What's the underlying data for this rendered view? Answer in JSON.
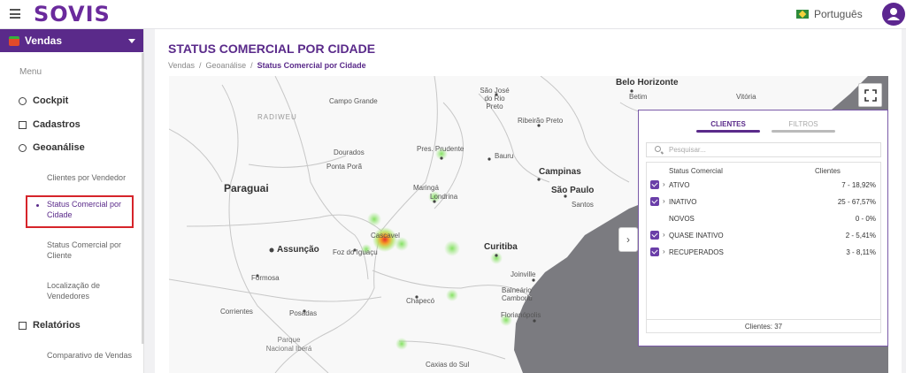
{
  "header": {
    "logo": "SOVIS",
    "language": "Português"
  },
  "sidebar": {
    "module": "Vendas",
    "menu_heading": "Menu",
    "items": [
      {
        "label": "Cockpit"
      },
      {
        "label": "Cadastros"
      },
      {
        "label": "Geoanálise"
      },
      {
        "label": "Relatórios"
      }
    ],
    "subitems": [
      {
        "label": "Clientes por Vendedor"
      },
      {
        "label": "Status Comercial por Cidade"
      },
      {
        "label": "Status Comercial por Cliente"
      },
      {
        "label": "Localização de Vendedores"
      },
      {
        "label": "Comparativo de Vendas"
      }
    ]
  },
  "page": {
    "title": "STATUS COMERCIAL POR CIDADE",
    "breadcrumb": [
      "Vendas",
      "Geoanálise",
      "Status Comercial por Cidade"
    ]
  },
  "map": {
    "labels": {
      "belo_horizonte": "Belo Horizonte",
      "betim": "Betim",
      "vitoria": "Vitória",
      "campo_grande": "Campo Grande",
      "sao_jose": "São José do Rio Preto",
      "ribeirao": "Ribeirão Preto",
      "dourados": "Dourados",
      "ponta_pora": "Ponta Porã",
      "pres_prudente": "Pres. Prudente",
      "bauru": "Bauru",
      "campinas": "Campinas",
      "sao_paulo": "São Paulo",
      "santos": "Santos",
      "paraguai": "Paraguai",
      "maringa": "Maringá",
      "londrina": "Londrina",
      "cascavel": "Cascavel",
      "assuncao": "Assunção",
      "foz": "Foz do Iguaçu",
      "curitiba": "Curitiba",
      "joinville": "Joinville",
      "balneario": "Balneário Camboriú",
      "formosa": "Formosa",
      "chapeco": "Chapecó",
      "florianopolis": "Florianópolis",
      "corrientes": "Corrientes",
      "posadas": "Posadas",
      "ibera": "Parque Nacional Iberá",
      "caxias": "Caxias do Sul",
      "bolivia": "RADIWEU"
    }
  },
  "panel": {
    "tabs": [
      "CLIENTES",
      "FILTROS"
    ],
    "search_placeholder": "Pesquisar...",
    "col_status": "Status Comercial",
    "col_clientes": "Clientes",
    "rows": [
      {
        "label": "ATIVO",
        "value": "7 - 18,92%"
      },
      {
        "label": "INATIVO",
        "value": "25 - 67,57%"
      },
      {
        "label": "NOVOS",
        "value": "0 - 0%"
      },
      {
        "label": "QUASE INATIVO",
        "value": "2 - 5,41%"
      },
      {
        "label": "RECUPERADOS",
        "value": "3 - 8,11%"
      }
    ],
    "footer": "Clientes: 37"
  },
  "colors": {
    "brand": "#5a2a8a",
    "heat_low": "#7ee05a",
    "heat_high": "#e8322a",
    "highlight_border": "#d6242a"
  }
}
